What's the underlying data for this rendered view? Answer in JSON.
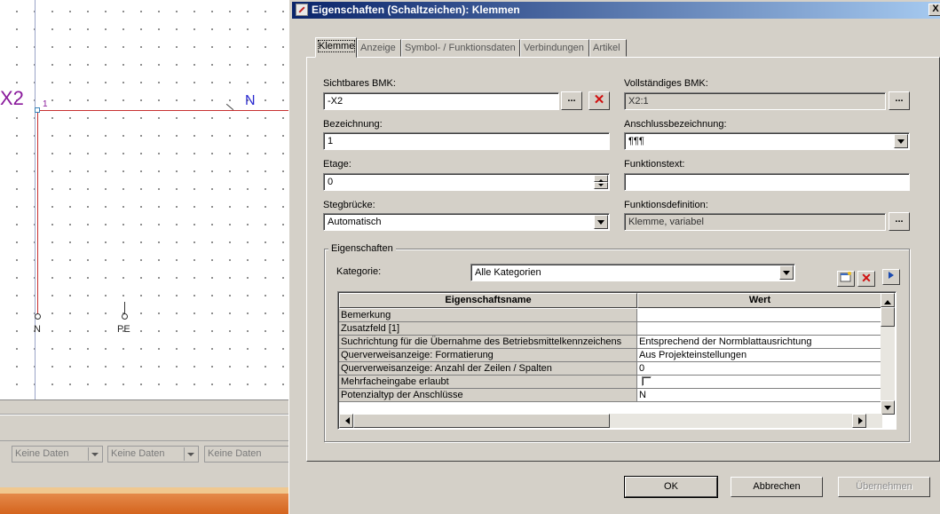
{
  "schematic": {
    "device_label": "X2",
    "pin_number": "1",
    "wire_label": "N",
    "terminal_labels": [
      "N",
      "PE"
    ]
  },
  "bottom_panel": {
    "combos": [
      "Keine Daten",
      "Keine Daten",
      "Keine Daten"
    ]
  },
  "dialog": {
    "title": "Eigenschaften (Schaltzeichen): Klemmen",
    "close_label": "X",
    "tabs": [
      {
        "label": "Klemme"
      },
      {
        "label": "Anzeige"
      },
      {
        "label": "Symbol- / Funktionsdaten"
      },
      {
        "label": "Verbindungen"
      },
      {
        "label": "Artikel"
      }
    ],
    "fields": {
      "sichtbares_bmk": {
        "label": "Sichtbares BMK:",
        "value": "-X2"
      },
      "vollstaendiges_bmk": {
        "label": "Vollständiges BMK:",
        "value": "X2:1"
      },
      "bezeichnung": {
        "label": "Bezeichnung:",
        "value": "1"
      },
      "anschlussbezeichnung": {
        "label": "Anschlussbezeichnung:",
        "value": "¶¶¶"
      },
      "etage": {
        "label": "Etage:",
        "value": "0"
      },
      "funktionstext": {
        "label": "Funktionstext:",
        "value": ""
      },
      "stegbruecke": {
        "label": "Stegbrücke:",
        "value": "Automatisch"
      },
      "funktionsdefinition": {
        "label": "Funktionsdefinition:",
        "value": "Klemme, variabel"
      }
    },
    "dots_label": "...",
    "delete_label": "✕",
    "properties_group": {
      "title": "Eigenschaften",
      "kategorie_label": "Kategorie:",
      "kategorie_value": "Alle Kategorien",
      "columns": [
        "Eigenschaftsname",
        "Wert"
      ],
      "rows": [
        {
          "name": "Bemerkung",
          "value": ""
        },
        {
          "name": "Zusatzfeld [1]",
          "value": ""
        },
        {
          "name": "Suchrichtung für die Übernahme des Betriebsmittelkennzeichens",
          "value": "Entsprechend der Normblattausrichtung"
        },
        {
          "name": "Querverweisanzeige: Formatierung",
          "value": "Aus Projekteinstellungen"
        },
        {
          "name": "Querverweisanzeige: Anzahl der Zeilen / Spalten",
          "value": "0"
        },
        {
          "name": "Mehrfacheingabe erlaubt",
          "value": ""
        },
        {
          "name": "Potenzialtyp der Anschlüsse",
          "value": "N"
        }
      ]
    },
    "buttons": {
      "ok": "OK",
      "cancel": "Abbrechen",
      "apply": "Übernehmen"
    }
  }
}
